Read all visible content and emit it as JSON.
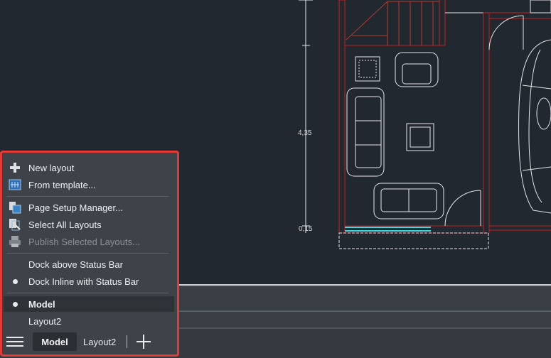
{
  "drawing": {
    "dimension_labels": [
      "4,35",
      "0,15"
    ]
  },
  "layout_menu": {
    "items": [
      {
        "label": "New layout",
        "icon": "plus-icon",
        "disabled": false
      },
      {
        "label": "From template...",
        "icon": "template-icon",
        "disabled": false
      },
      {
        "label": "Page Setup Manager...",
        "icon": "page-setup-icon",
        "disabled": false
      },
      {
        "label": "Select All Layouts",
        "icon": "select-layouts-icon",
        "disabled": false
      },
      {
        "label": "Publish Selected Layouts...",
        "icon": "printer-icon",
        "disabled": true
      },
      {
        "label": "Dock above Status Bar",
        "icon": "",
        "checked": false
      },
      {
        "label": "Dock Inline with Status Bar",
        "icon": "radio-dot-icon",
        "checked": true
      },
      {
        "label": "Model",
        "icon": "radio-dot-icon",
        "checked": true
      },
      {
        "label": "Layout2",
        "icon": "",
        "checked": false
      }
    ]
  },
  "layout_tabs": {
    "model_label": "Model",
    "layout2_label": "Layout2"
  },
  "colors": {
    "menu_border": "#e53935",
    "canvas_bg": "#212830",
    "wall_red": "#c41f1f",
    "stair_red": "#b33a2a",
    "cyan": "#3fd8e0"
  }
}
